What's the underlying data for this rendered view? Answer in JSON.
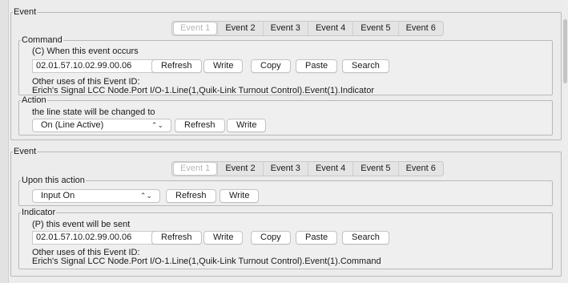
{
  "tabs": [
    "Event 1",
    "Event 2",
    "Event 3",
    "Event 4",
    "Event 5",
    "Event 6"
  ],
  "event_block_1": {
    "legend": "Event",
    "command": {
      "legend": "Command",
      "description": "(C) When this event occurs",
      "event_id": "02.01.57.10.02.99.00.06",
      "buttons": {
        "refresh": "Refresh",
        "write": "Write",
        "copy": "Copy",
        "paste": "Paste",
        "search": "Search"
      },
      "other_uses_label": "Other uses of this Event ID:",
      "other_uses_value": "Erich's Signal LCC Node.Port I/O-1.Line(1,Quik-Link Turnout Control).Event(1).Indicator"
    },
    "action": {
      "legend": "Action",
      "description": "the line state will be changed to",
      "selected": "On  (Line Active)",
      "buttons": {
        "refresh": "Refresh",
        "write": "Write"
      }
    }
  },
  "event_block_2": {
    "legend": "Event",
    "upon_action": {
      "legend": "Upon this action",
      "selected": "Input On",
      "buttons": {
        "refresh": "Refresh",
        "write": "Write"
      }
    },
    "indicator": {
      "legend": "Indicator",
      "description": "(P) this event will be sent",
      "event_id": "02.01.57.10.02.99.00.06",
      "buttons": {
        "refresh": "Refresh",
        "write": "Write",
        "copy": "Copy",
        "paste": "Paste",
        "search": "Search"
      },
      "other_uses_label": "Other uses of this Event ID:",
      "other_uses_value": "Erich's Signal LCC Node.Port I/O-1.Line(1,Quik-Link Turnout Control).Event(1).Command"
    }
  }
}
